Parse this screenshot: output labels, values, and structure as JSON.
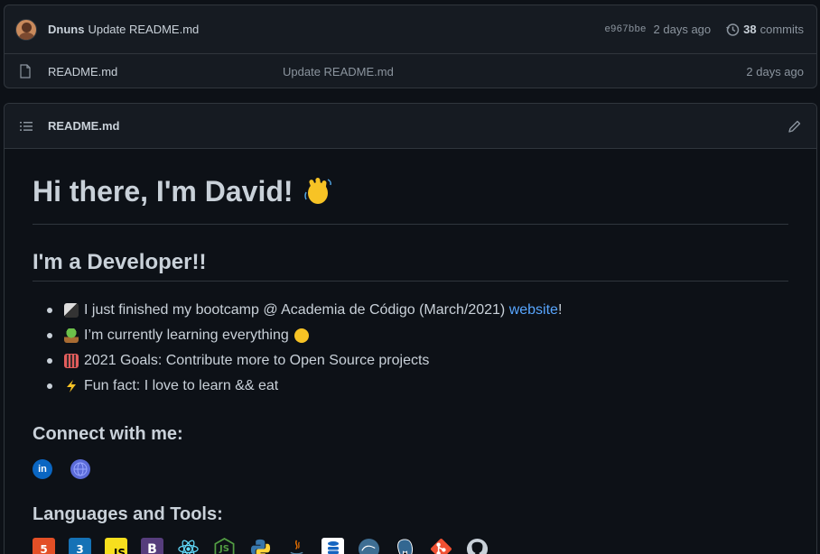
{
  "commit": {
    "author": "Dnuns",
    "message": "Update README.md",
    "sha": "e967bbe",
    "time": "2 days ago",
    "commit_count": "38",
    "commits_label": "commits"
  },
  "file": {
    "name": "README.md",
    "message": "Update README.md",
    "time": "2 days ago"
  },
  "readme": {
    "title": "README.md",
    "h1": "Hi there, I'm David!",
    "h2": "I'm a Developer!!",
    "bullets": {
      "b1_text": "I just finished my bootcamp @ Academia de Código (March/2021)",
      "b1_link": "website",
      "b1_end": "!",
      "b2": "I’m currently learning everything",
      "b3": "2021 Goals: Contribute more to Open Source projects",
      "b4": "Fun fact: I love to learn && eat"
    },
    "connect_heading": "Connect with me:",
    "languages_heading": "Languages and Tools:",
    "tools": {
      "html5": "5",
      "css3": "3",
      "javascript": "JS",
      "bootstrap": "B",
      "nodejs": "JS"
    }
  },
  "colors": {
    "link": "#58a6ff",
    "background": "#0d1117",
    "panel": "#161b22",
    "border": "#30363d"
  }
}
